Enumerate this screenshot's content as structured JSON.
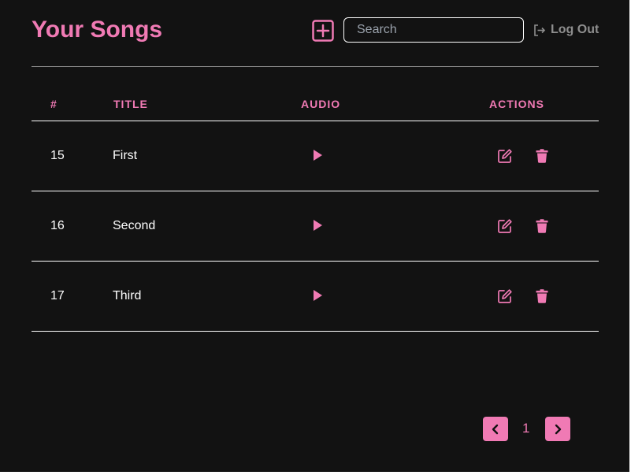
{
  "header": {
    "title": "Your Songs",
    "add_icon": "plus-square-icon",
    "search": {
      "placeholder": "Search",
      "value": ""
    },
    "logout_icon": "logout-icon",
    "logout_label": "Log Out"
  },
  "table": {
    "columns": [
      "#",
      "TITLE",
      "AUDIO",
      "ACTIONS"
    ],
    "rows": [
      {
        "id": "15",
        "title": "First"
      },
      {
        "id": "16",
        "title": "Second"
      },
      {
        "id": "17",
        "title": "Third"
      }
    ],
    "row_icons": {
      "audio": "play-icon",
      "edit": "edit-icon",
      "delete": "trash-icon"
    }
  },
  "pagination": {
    "prev_icon": "chevron-left-icon",
    "current_page": "1",
    "next_icon": "chevron-right-icon"
  },
  "colors": {
    "background": "#121212",
    "accent": "#f07ab4",
    "text": "#ffffff",
    "muted": "#8e8e8e"
  }
}
